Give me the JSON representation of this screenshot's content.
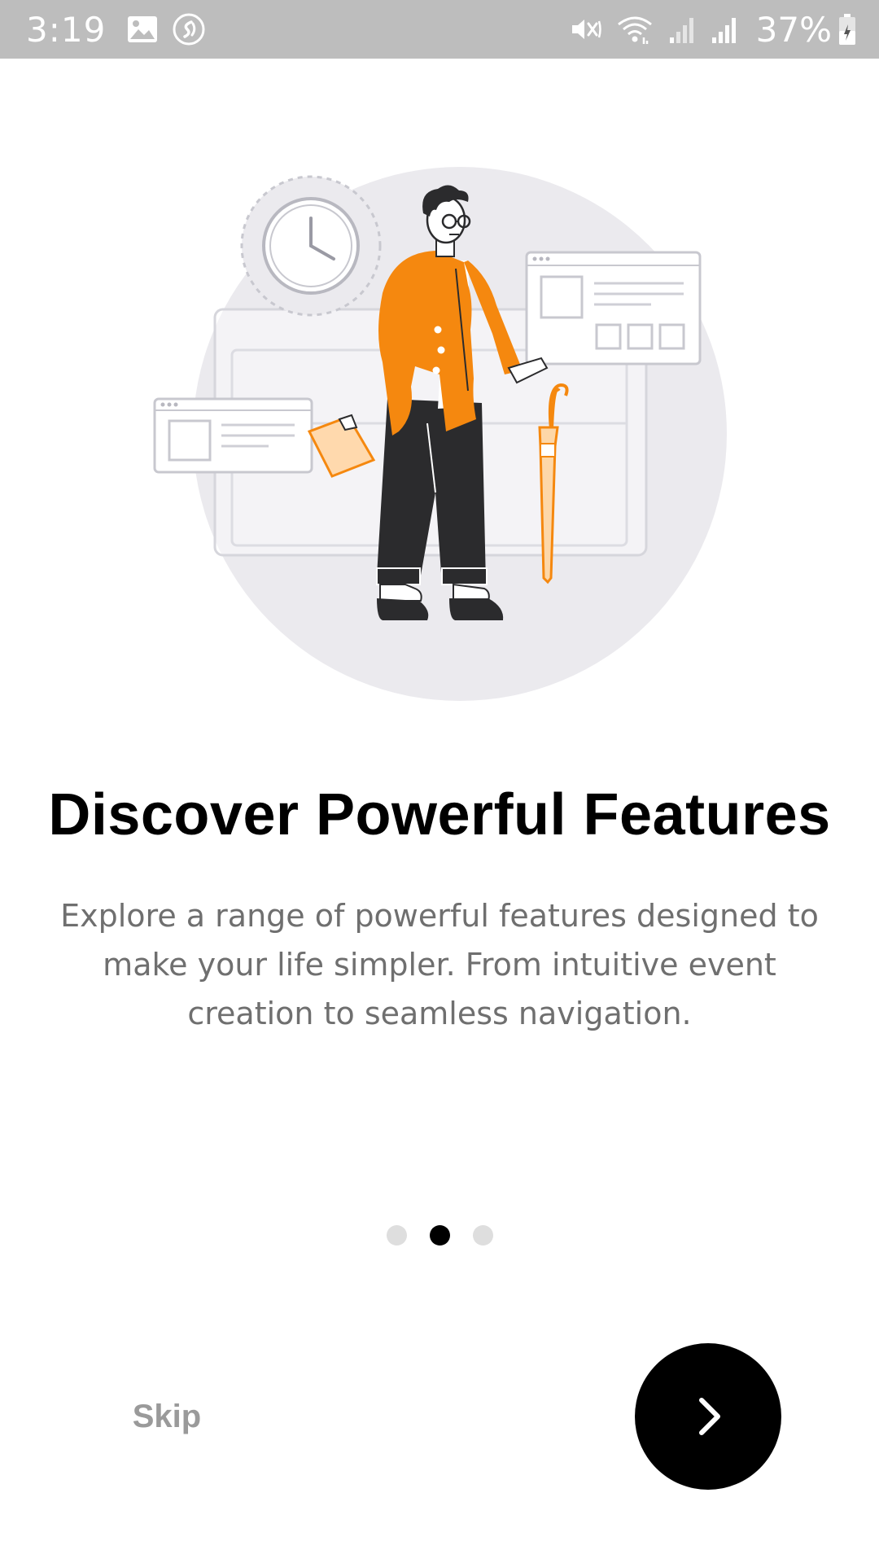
{
  "status_bar": {
    "time": "3:19",
    "battery": "37%",
    "left_icons": [
      "gallery-icon",
      "shazam-icon"
    ],
    "right_icons": [
      "mute-vibrate-icon",
      "wifi-icon",
      "signal-icon",
      "signal-icon",
      "battery-charging-icon"
    ]
  },
  "onboarding": {
    "title": "Discover Powerful Features",
    "description": "Explore a range of powerful features designed to make your life simpler. From intuitive event creation to seamless navigation.",
    "page_count": 3,
    "current_page": 2
  },
  "actions": {
    "skip_label": "Skip",
    "next_icon": "chevron-right-icon"
  },
  "colors": {
    "accent": "#F5880F",
    "dark": "#000000",
    "muted_text": "#6F6F6F",
    "status_bar": "#BDBDBD"
  }
}
